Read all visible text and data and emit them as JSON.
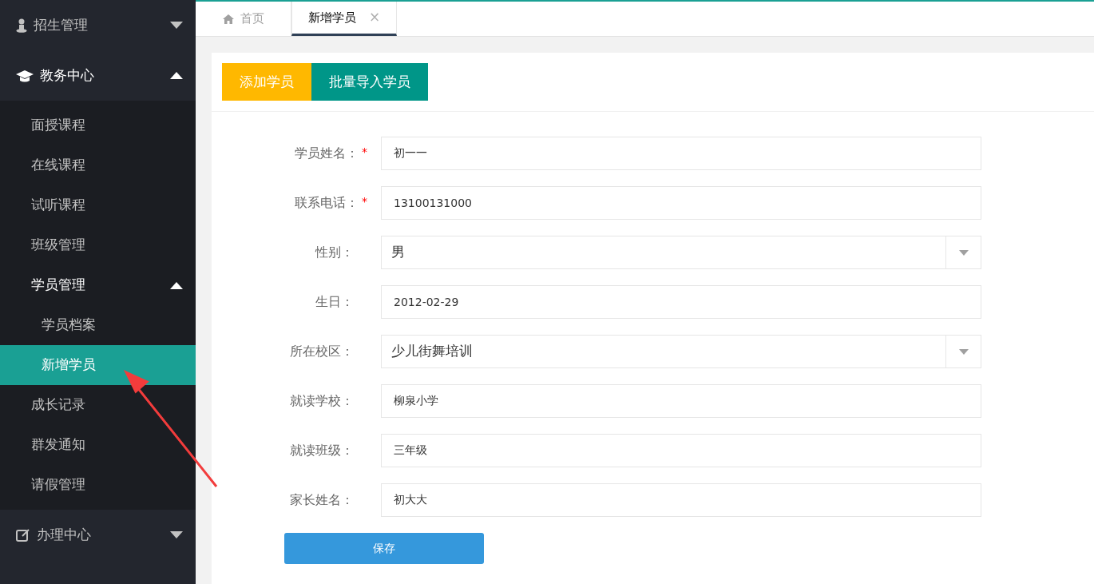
{
  "sidebar": {
    "groups": [
      {
        "kind": "user",
        "label": "招生管理",
        "expanded": false
      },
      {
        "kind": "cap",
        "label": "教务中心",
        "expanded": true,
        "children": [
          {
            "label": "面授课程",
            "selected": false
          },
          {
            "label": "在线课程",
            "selected": false
          },
          {
            "label": "试听课程",
            "selected": false
          },
          {
            "label": "班级管理",
            "selected": false
          },
          {
            "label": "学员管理",
            "selected": false,
            "expanded": true,
            "children": [
              {
                "label": "学员档案",
                "selected": false
              },
              {
                "label": "新增学员",
                "selected": true
              }
            ]
          },
          {
            "label": "成长记录",
            "selected": false
          },
          {
            "label": "群发通知",
            "selected": false
          },
          {
            "label": "请假管理",
            "selected": false
          }
        ]
      },
      {
        "kind": "edit",
        "label": "办理中心",
        "expanded": false
      }
    ]
  },
  "tabs": [
    {
      "label": "首页",
      "selected": false,
      "kind": "home"
    },
    {
      "label": "新增学员",
      "selected": true,
      "kind": "closable",
      "close": "×"
    }
  ],
  "actions": [
    {
      "label": "添加学员",
      "kind": "primary"
    },
    {
      "label": "批量导入学员",
      "kind": "secondary"
    }
  ],
  "form": {
    "fields": [
      {
        "label": "学员姓名：",
        "mark": "*",
        "kind": "text",
        "value": "初一一"
      },
      {
        "label": "联系电话：",
        "mark": "*",
        "kind": "text",
        "value": "13100131000"
      },
      {
        "label": "性别：",
        "kind": "select",
        "value": "男"
      },
      {
        "label": "生日：",
        "kind": "text",
        "value": "2012-02-29"
      },
      {
        "label": "所在校区：",
        "kind": "select",
        "value": "少儿街舞培训"
      },
      {
        "label": "就读学校：",
        "kind": "text",
        "value": "柳泉小学"
      },
      {
        "label": "就读班级：",
        "kind": "text",
        "value": "三年级"
      },
      {
        "label": "家长姓名：",
        "kind": "text",
        "value": "初大大"
      }
    ],
    "submit": "保存"
  }
}
